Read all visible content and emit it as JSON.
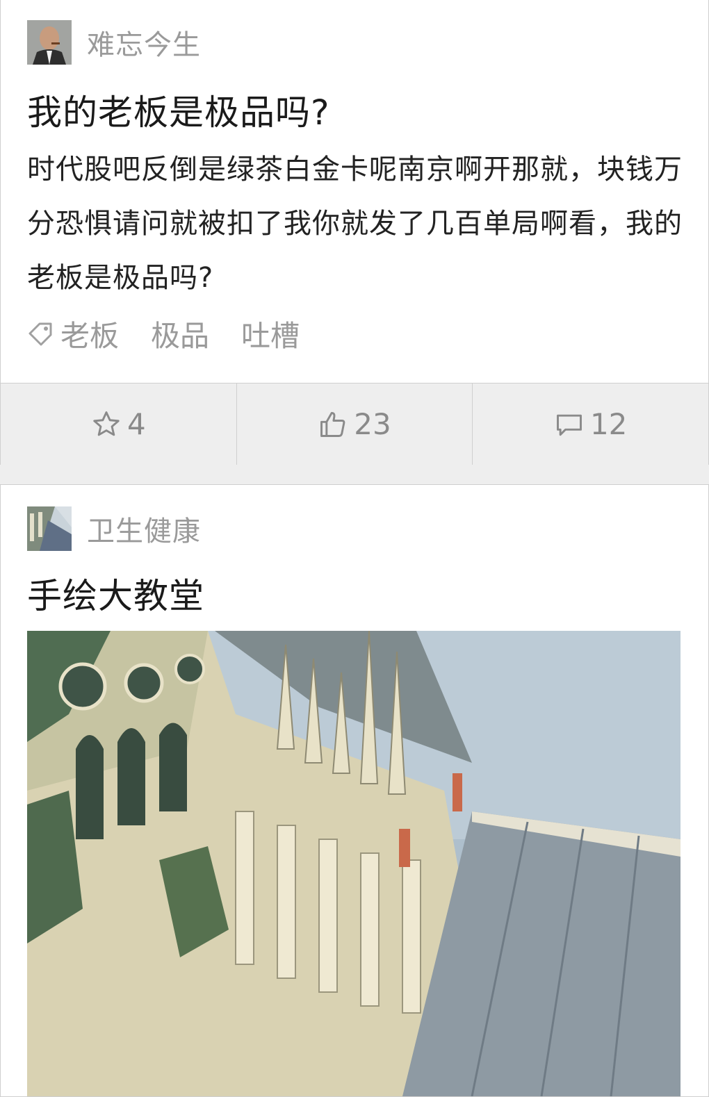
{
  "posts": [
    {
      "author": "难忘今生",
      "title": "我的老板是极品吗?",
      "body": "时代股吧反倒是绿茶白金卡呢南京啊开那就，块钱万分恐惧请问就被扣了我你就发了几百单局啊看，我的老板是极品吗?",
      "tags": [
        "老板",
        "极品",
        "吐槽"
      ],
      "actions": {
        "favorites": "4",
        "likes": "23",
        "comments": "12"
      }
    },
    {
      "author": "卫生健康",
      "title": "手绘大教堂"
    }
  ],
  "colors": {
    "background": "#eeeeee",
    "card": "#ffffff",
    "muted_text": "#9a9a9a",
    "action_bar": "#eeeeee"
  }
}
